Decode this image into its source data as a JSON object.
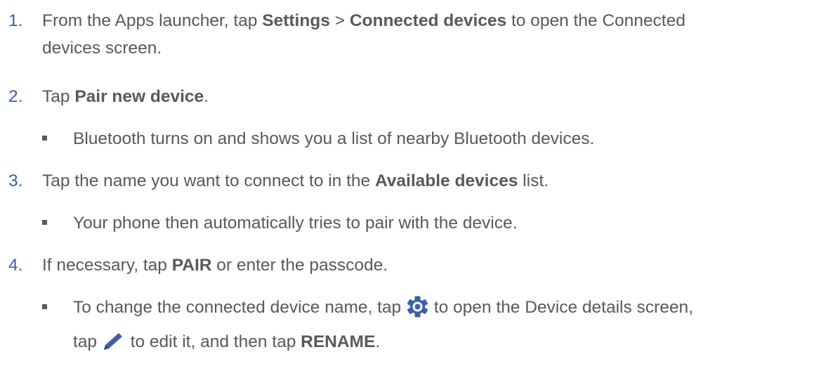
{
  "steps": [
    {
      "number": "1.",
      "part1": "From the Apps launcher, tap ",
      "bold1": "Settings",
      "part2": " > ",
      "bold2": "Connected devices",
      "part3": " to open the Connected",
      "line2": "devices screen."
    },
    {
      "number": "2.",
      "part1": "Tap ",
      "bold1": "Pair new device",
      "part2": ".",
      "sub": "Bluetooth turns on and shows you a list of nearby Bluetooth devices."
    },
    {
      "number": "3.",
      "part1": "Tap the name you want to connect to in the ",
      "bold1": "Available devices",
      "part2": " list.",
      "sub": "Your phone then automatically tries to pair with the device."
    },
    {
      "number": "4.",
      "part1": "If necessary, tap ",
      "bold1": "PAIR",
      "part2": " or enter the passcode.",
      "sub": {
        "part1": "To change the connected device name, tap ",
        "icon1": "gear-settings-icon",
        "part2": " to open the Device details screen,",
        "part3": "tap ",
        "icon2": "pencil-edit-icon",
        "part4": " to edit it, and then tap ",
        "bold1": "RENAME",
        "part5": "."
      }
    }
  ],
  "colors": {
    "text": "#595959",
    "number": "#3f5fa8",
    "icon": "#3f5fa8"
  }
}
